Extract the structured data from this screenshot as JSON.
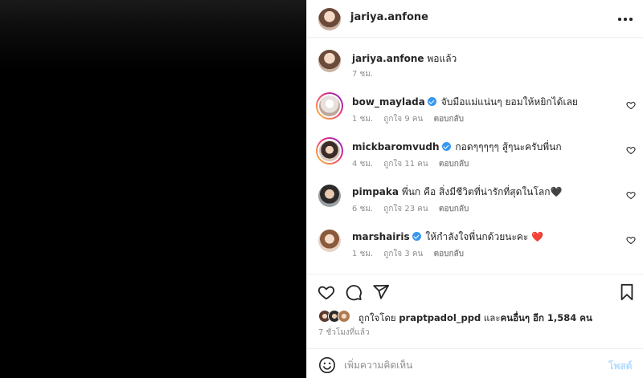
{
  "post": {
    "username": "jariya.anfone",
    "caption": "พอแล้ว",
    "caption_time": "7 ชม."
  },
  "comments": [
    {
      "username": "bow_maylada",
      "verified": true,
      "text": "จับมือแม่แน่นๆ ยอมให้หยิกได้เลย",
      "time": "1 ชม.",
      "likes": "ถูกใจ 9 คน",
      "reply": "ตอบกลับ",
      "story_ring": true
    },
    {
      "username": "mickbaromvudh",
      "verified": true,
      "text": "กอดๆๆๆๆๆ สู้ๆนะครับพี่นก",
      "time": "4 ชม.",
      "likes": "ถูกใจ 11 คน",
      "reply": "ตอบกลับ",
      "story_ring": true
    },
    {
      "username": "pimpaka",
      "verified": false,
      "text": "พี่นก คือ สิ่งมีชีวิตที่น่ารักที่สุดในโลก",
      "emoji": "🖤",
      "time": "6 ชม.",
      "likes": "ถูกใจ 23 คน",
      "reply": "ตอบกลับ",
      "story_ring": false
    },
    {
      "username": "marshairis",
      "verified": true,
      "text": "ให้กำลังใจพี่นกด้วยนะคะ",
      "emoji": "❤️",
      "time": "1 ชม.",
      "likes": "ถูกใจ 3 คน",
      "reply": "ตอบกลับ",
      "story_ring": false
    }
  ],
  "likes": {
    "prefix": "ถูกใจโดย",
    "user": "praptpadol_ppd",
    "and": "และ",
    "others": "คนอื่นๆ อีก 1,584 คน"
  },
  "time_ago": "7 ชั่วโมงที่แล้ว",
  "comment_box": {
    "placeholder": "เพิ่มความคิดเห็น",
    "post_label": "โพสต์"
  },
  "icons": {
    "more": "more-horizontal-icon",
    "like": "heart-icon",
    "comment": "comment-bubble-icon",
    "share": "paper-plane-icon",
    "save": "bookmark-icon",
    "emoji": "emoji-smile-icon",
    "verified": "verified-badge-icon"
  },
  "colors": {
    "verified": "#3897f0",
    "post_button": "#b3dbff",
    "meta_text": "#8e8e8e"
  }
}
